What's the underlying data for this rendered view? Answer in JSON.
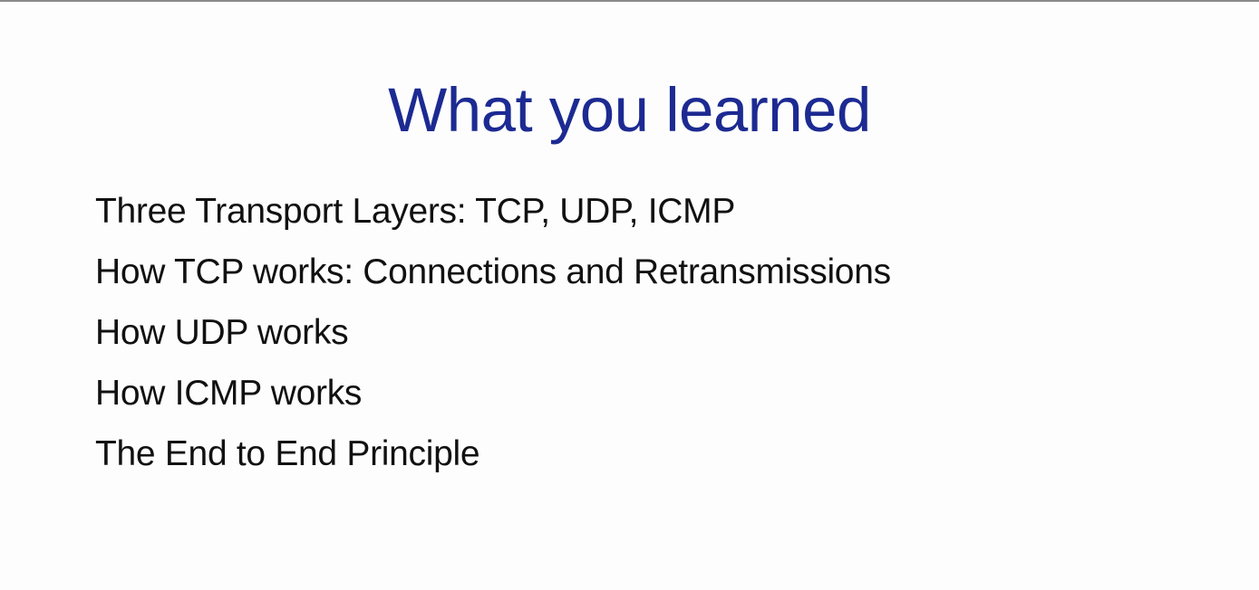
{
  "slide": {
    "title": "What you learned",
    "title_color": "#1c2a92",
    "items": [
      "Three Transport Layers: TCP, UDP, ICMP",
      "How TCP works: Connections and Retransmissions",
      "How UDP works",
      "How ICMP works",
      "The End to End Principle"
    ]
  }
}
